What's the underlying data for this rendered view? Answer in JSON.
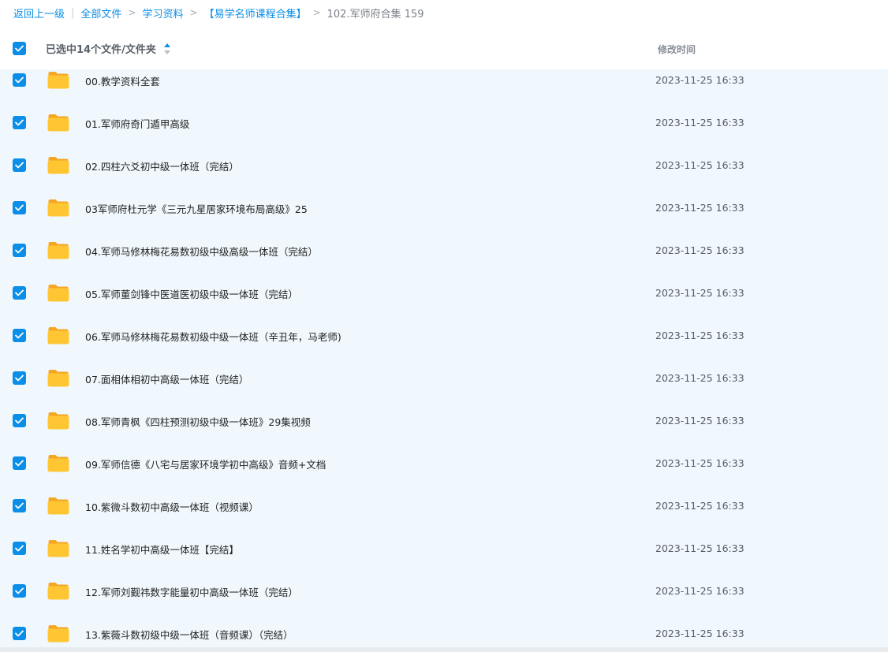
{
  "breadcrumb": {
    "back": "返回上一级",
    "sep": "|",
    "items": [
      {
        "label": "全部文件"
      },
      {
        "label": "学习资料"
      },
      {
        "label": "【易学名师课程合集】"
      }
    ],
    "arrow": ">",
    "current": "102.军师府合集 159"
  },
  "header": {
    "select_all_checked": true,
    "name_label": "已选中14个文件/文件夹",
    "time_label": "修改时间"
  },
  "files": [
    {
      "name": "00.教学资料全套",
      "time": "2023-11-25 16:33",
      "checked": true,
      "icon": "folder-icon"
    },
    {
      "name": "01.军师府奇门遁甲高级",
      "time": "2023-11-25 16:33",
      "checked": true,
      "icon": "folder-icon"
    },
    {
      "name": "02.四柱六爻初中级一体班（完结）",
      "time": "2023-11-25 16:33",
      "checked": true,
      "icon": "folder-icon"
    },
    {
      "name": "03军师府杜元学《三元九星居家环境布局高级》25",
      "time": "2023-11-25 16:33",
      "checked": true,
      "icon": "folder-icon"
    },
    {
      "name": "04.军师马修林梅花易数初级中级高级一体班（完结）",
      "time": "2023-11-25 16:33",
      "checked": true,
      "icon": "folder-icon"
    },
    {
      "name": "05.军师董剑锋中医道医初级中级一体班（完结）",
      "time": "2023-11-25 16:33",
      "checked": true,
      "icon": "folder-icon"
    },
    {
      "name": "06.军师马修林梅花易数初级中级一体班（辛丑年，马老师)",
      "time": "2023-11-25 16:33",
      "checked": true,
      "icon": "folder-icon"
    },
    {
      "name": "07.面相体相初中高级一体班（完结）",
      "time": "2023-11-25 16:33",
      "checked": true,
      "icon": "folder-icon"
    },
    {
      "name": "08.军师青枫《四柱预测初级中级一体班》29集视频",
      "time": "2023-11-25 16:33",
      "checked": true,
      "icon": "folder-icon"
    },
    {
      "name": "09.军师信德《八宅与居家环境学初中高级》音频+文档",
      "time": "2023-11-25 16:33",
      "checked": true,
      "icon": "folder-icon"
    },
    {
      "name": "10.紫微斗数初中高级一体班（视频课）",
      "time": "2023-11-25 16:33",
      "checked": true,
      "icon": "folder-icon"
    },
    {
      "name": "11.姓名学初中高级一体班【完结】",
      "time": "2023-11-25 16:33",
      "checked": true,
      "icon": "folder-icon"
    },
    {
      "name": "12.军师刘觐祎数字能量初中高级一体班（完结）",
      "time": "2023-11-25 16:33",
      "checked": true,
      "icon": "folder-icon"
    },
    {
      "name": "13.紫薇斗数初级中级一体班（音频课）（完结）",
      "time": "2023-11-25 16:33",
      "checked": true,
      "icon": "folder-icon"
    }
  ],
  "colors": {
    "accent": "#0a8ee8",
    "row_selected_bg": "#f0f8fd",
    "folder_body": "#ffc634",
    "folder_tab": "#f5a623"
  }
}
